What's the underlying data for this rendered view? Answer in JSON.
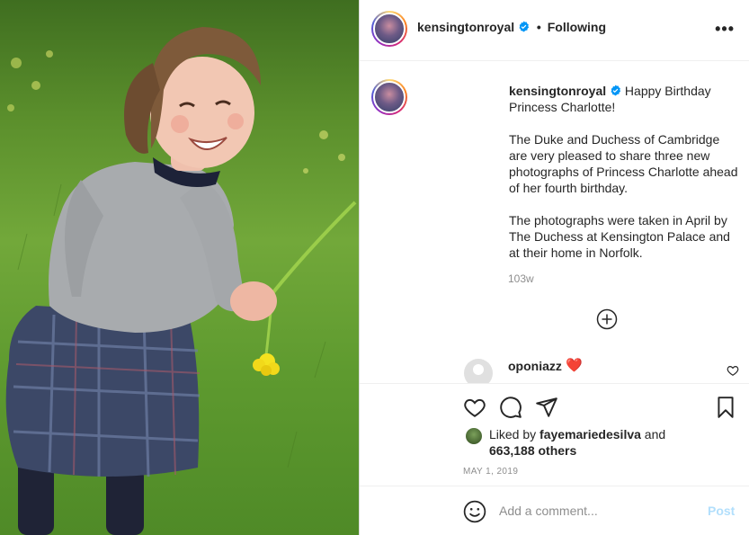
{
  "post": {
    "photo_alt": "photo",
    "author": {
      "username": "kensingtonroyal",
      "verified_icon": "verified-badge-icon",
      "follow_status": "Following",
      "separator": "•"
    },
    "caption": {
      "username": "kensingtonroyal",
      "text_line1": "Happy Birthday Princess Charlotte!",
      "paragraph2": "The Duke and Duchess of Cambridge are very pleased to share three new photographs of Princess Charlotte ahead of her fourth birthday.",
      "paragraph3": "The photographs were taken in April by The Duchess at Kensington Palace and at their home in Norfolk.",
      "time_ago": "103w"
    },
    "comments": [
      {
        "username": "oponiazz",
        "text": "❤️"
      }
    ],
    "likes": {
      "prefix": "Liked by",
      "first_liker": "fayemariedesilva",
      "connector": "and",
      "others_count": "663,188 others"
    },
    "date": "MAY 1, 2019",
    "add_comment": {
      "placeholder": "Add a comment...",
      "post_label": "Post"
    }
  },
  "colors": {
    "accent_blue": "#0095f6",
    "post_disabled": "#b2dffc",
    "muted_text": "#8e8e8e",
    "heart_red": "#e0245e"
  }
}
